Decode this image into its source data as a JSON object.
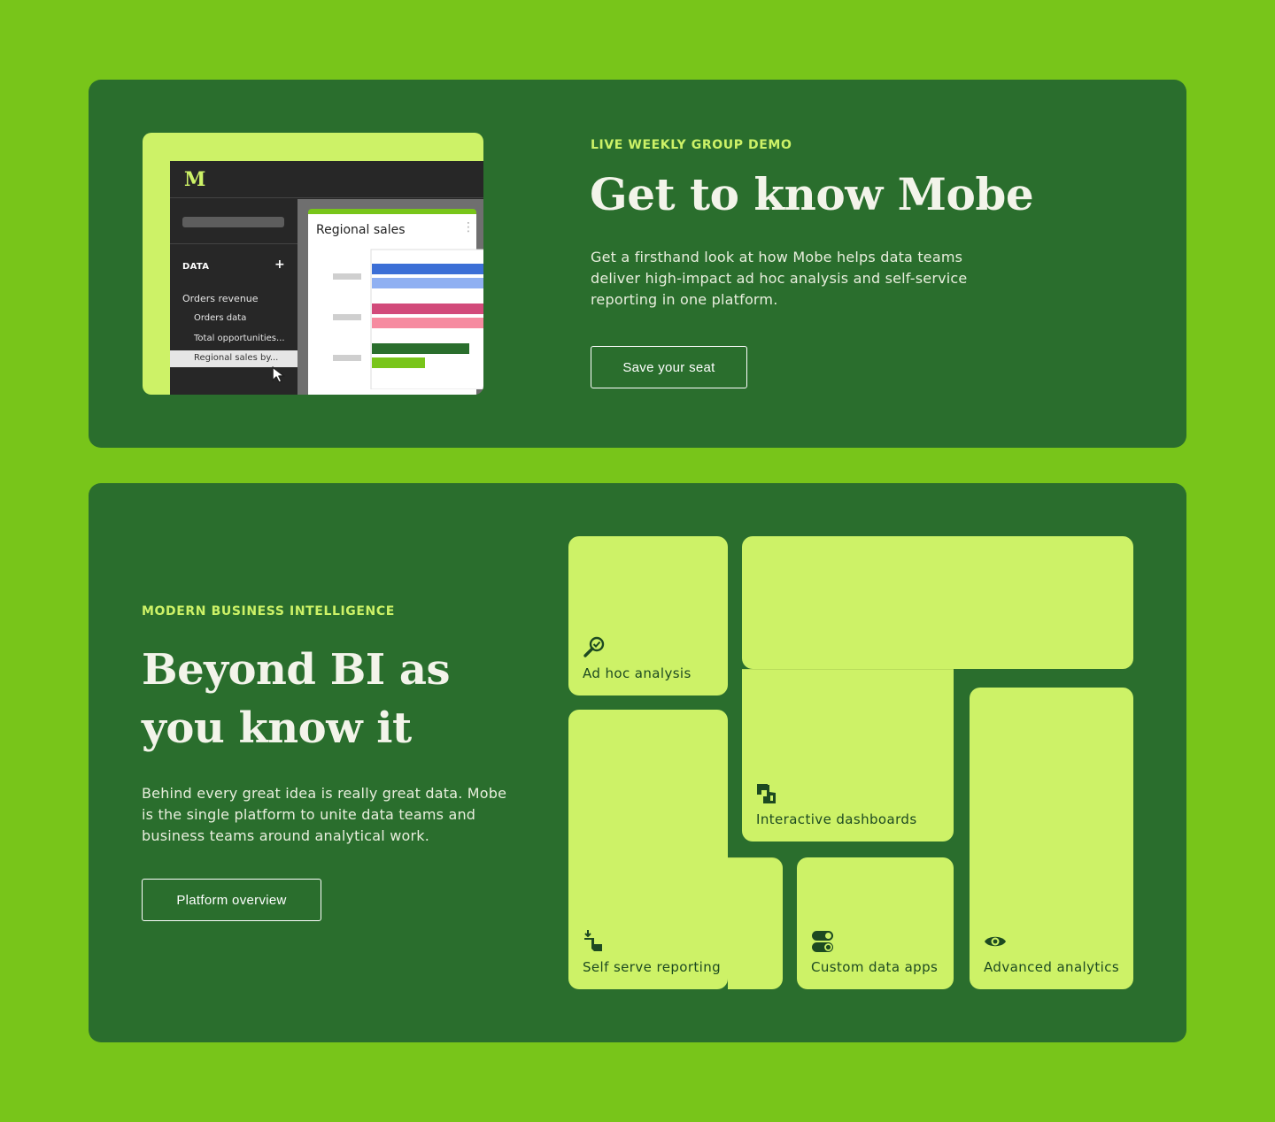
{
  "demo": {
    "mock": {
      "logo": "M",
      "data_label": "DATA",
      "plus": "+",
      "items": [
        "Orders revenue",
        "Orders data",
        "Total opportunities...",
        "Regional sales by..."
      ],
      "panel_title": "Regional sales",
      "panel_menu": "⋮"
    },
    "eyebrow": "LIVE WEEKLY GROUP DEMO",
    "title": "Get to know Mobe",
    "body": "Get a firsthand look at how Mobe helps data teams deliver high-impact ad hoc analysis and self-service reporting in one platform.",
    "cta": "Save your seat"
  },
  "bi": {
    "eyebrow": "MODERN BUSINESS INTELLIGENCE",
    "title": "Beyond BI as you know it",
    "body": "Behind every great idea is really great data. Mobe is the single platform to unite data teams and business teams around analytical work.",
    "cta": "Platform overview",
    "tiles": {
      "adhoc": "Ad hoc analysis",
      "dashboards": "Interactive dashboards",
      "self_serve": "Self serve reporting",
      "apps": "Custom data apps",
      "advanced": "Advanced analytics"
    }
  },
  "colors": {
    "page_bg": "#78c51a",
    "card_bg": "#2a6e2d",
    "accent": "#cdf267",
    "tile_text": "#1d4a21"
  }
}
